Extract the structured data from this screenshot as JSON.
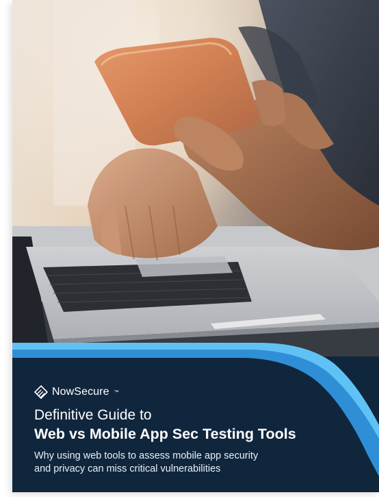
{
  "cover": {
    "brand": {
      "name": "NowSecure",
      "trademark": "™",
      "logo_icon": "nowsecure-logo-icon"
    },
    "title": {
      "line1": "Definitive Guide to",
      "line2": "Web vs Mobile App Sec Testing Tools"
    },
    "subtitle": {
      "line1": "Why using web tools to assess mobile app security",
      "line2": "and privacy can miss critical vulnerabilities"
    },
    "colors": {
      "background": "#10263d",
      "accent_light": "#60c2f4",
      "accent_mid": "#2f8fd6",
      "text": "#ffffff"
    }
  }
}
